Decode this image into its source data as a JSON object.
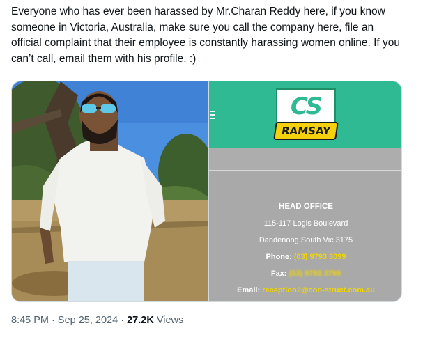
{
  "post": {
    "text": "Everyone who has ever been harassed by Mr.Charan Reddy here, if you know someone in Victoria, Australia, make sure you call the company here, file an official complaint that their employee is constantly harassing women online. If you can’t call, email them with his profile. :)"
  },
  "media": {
    "logo": {
      "mark": "CS",
      "wordmark": "RAMSAY"
    },
    "office": {
      "heading": "HEAD OFFICE",
      "address_line1": "115-117 Logis Boulevard",
      "address_line2": "Dandenong South Vic 3175",
      "phone_label": "Phone:",
      "phone_value": "(03) 9793 3099",
      "fax_label": "Fax:",
      "fax_value": "(03) 9793 3799",
      "email_label": "Email:",
      "email_value": "reception2@con-struct.com.au"
    },
    "colors": {
      "brand_green": "#2fba94",
      "brand_yellow": "#f5d10d",
      "panel_grey": "#a9a9a9"
    }
  },
  "meta": {
    "time": "8:45 PM",
    "separator": "·",
    "date": "Sep 25, 2024",
    "views_count": "27.2K",
    "views_label": "Views"
  }
}
